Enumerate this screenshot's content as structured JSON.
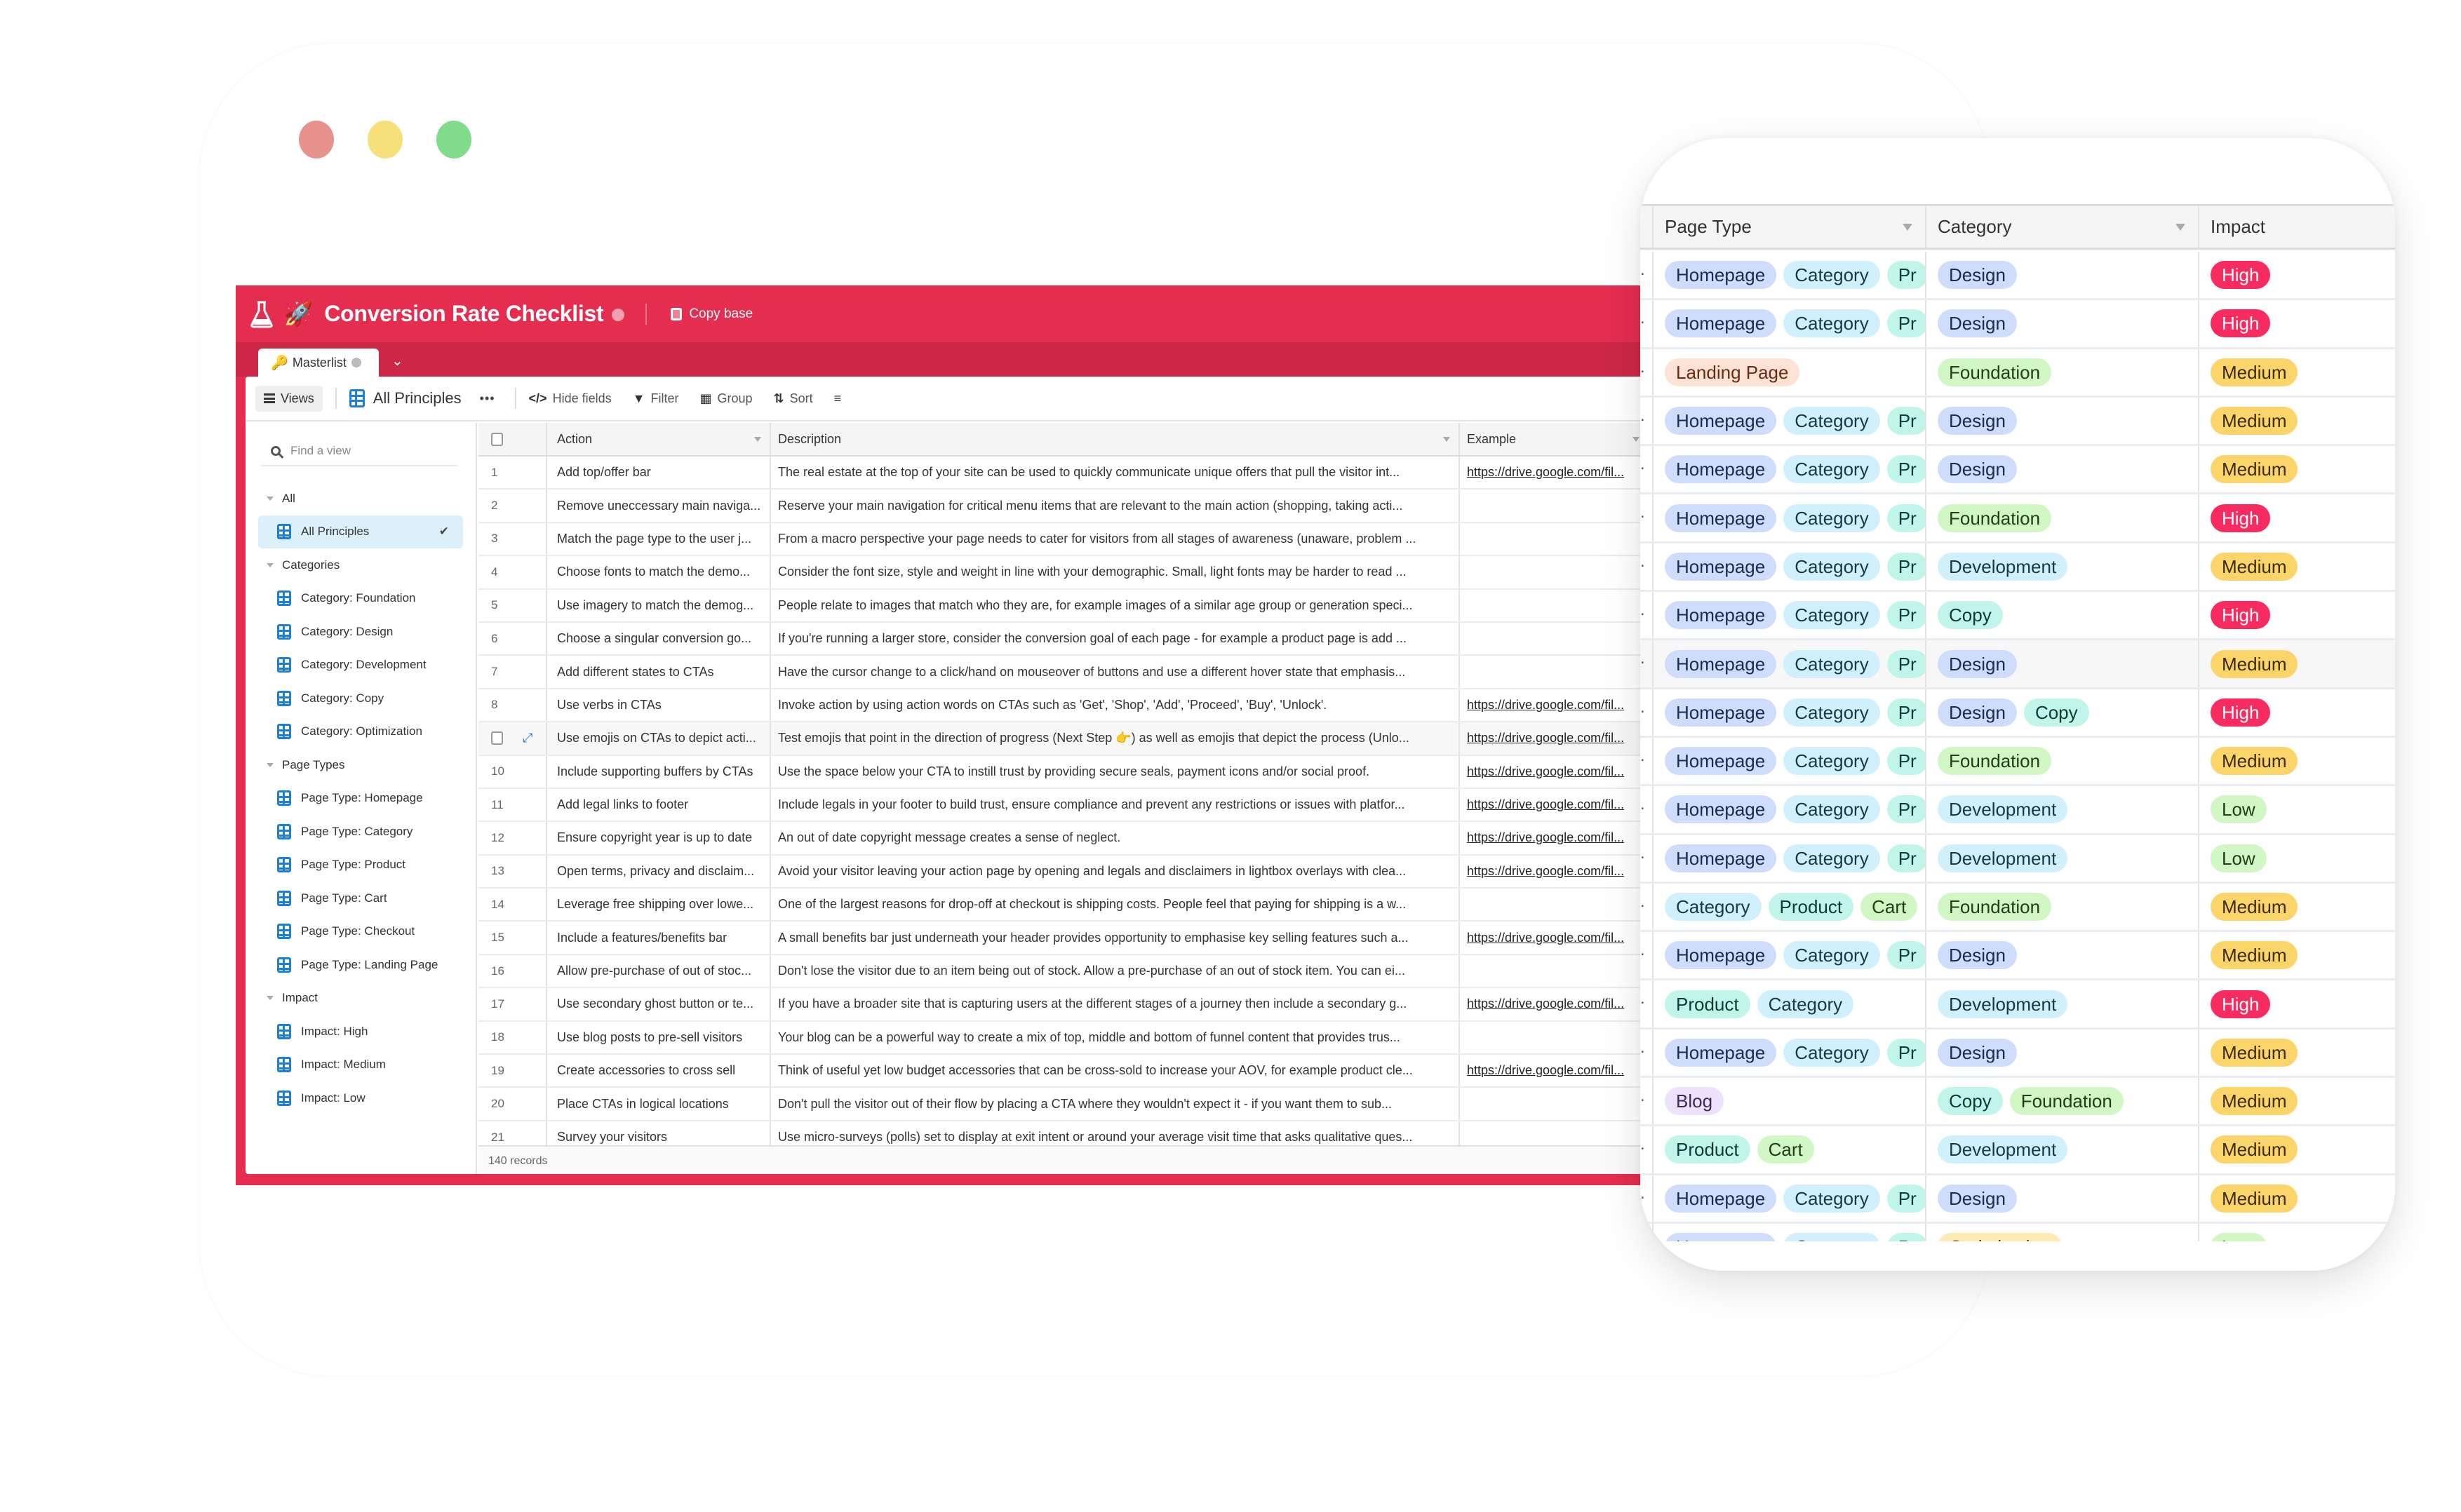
{
  "window_controls": [
    "close",
    "minimize",
    "maximize"
  ],
  "app": {
    "title": "Conversion Rate Checklist",
    "copy_base_label": "Copy base",
    "tab_label": "Masterlist",
    "toolbar": {
      "views_label": "Views",
      "current_view": "All Principles",
      "more_label": "•••",
      "hide_fields": "Hide fields",
      "filter": "Filter",
      "group": "Group",
      "sort": "Sort"
    },
    "sidebar": {
      "find_placeholder": "Find a view",
      "sections": [
        {
          "label": "All",
          "items": [
            {
              "label": "All Principles",
              "active": true
            }
          ]
        },
        {
          "label": "Categories",
          "items": [
            {
              "label": "Category: Foundation"
            },
            {
              "label": "Category: Design"
            },
            {
              "label": "Category: Development"
            },
            {
              "label": "Category: Copy"
            },
            {
              "label": "Category: Optimization"
            }
          ]
        },
        {
          "label": "Page Types",
          "items": [
            {
              "label": "Page Type: Homepage"
            },
            {
              "label": "Page Type: Category"
            },
            {
              "label": "Page Type: Product"
            },
            {
              "label": "Page Type: Cart"
            },
            {
              "label": "Page Type: Checkout"
            },
            {
              "label": "Page Type: Landing Page"
            }
          ]
        },
        {
          "label": "Impact",
          "items": [
            {
              "label": "Impact: High"
            },
            {
              "label": "Impact: Medium"
            },
            {
              "label": "Impact: Low"
            }
          ]
        }
      ]
    },
    "grid": {
      "columns": [
        "Action",
        "Description",
        "Example"
      ],
      "rows": [
        {
          "num": "1",
          "action": "Add top/offer bar",
          "description": "The real estate at the top of your site can be used to quickly communicate unique offers that pull the visitor int...",
          "example": "https://drive.google.com/fil..."
        },
        {
          "num": "2",
          "action": "Remove uneccessary main naviga...",
          "description": "Reserve your main navigation for critical menu items that are relevant to the main action (shopping, taking acti...",
          "example": ""
        },
        {
          "num": "3",
          "action": "Match the page type to the user j...",
          "description": "From a macro perspective your page needs to cater for visitors from all stages of awareness (unaware, problem ...",
          "example": ""
        },
        {
          "num": "4",
          "action": "Choose fonts to match the demo...",
          "description": "Consider the font size, style and weight in line with your demographic. Small, light fonts may be harder to read ...",
          "example": ""
        },
        {
          "num": "5",
          "action": "Use imagery to match the demog...",
          "description": "People relate to images that match who they are, for example images of a similar age group or generation speci...",
          "example": ""
        },
        {
          "num": "6",
          "action": "Choose a singular conversion go...",
          "description": "If you're running a larger store, consider the conversion goal of each page - for example a product page is add ...",
          "example": ""
        },
        {
          "num": "7",
          "action": "Add different states to CTAs",
          "description": "Have the cursor change to a click/hand on mouseover of buttons and use a different hover state that emphasis...",
          "example": ""
        },
        {
          "num": "8",
          "action": "Use verbs in CTAs",
          "description": "Invoke action by using action words on CTAs such as 'Get', 'Shop', 'Add', 'Proceed', 'Buy', 'Unlock'.",
          "example": "https://drive.google.com/fil..."
        },
        {
          "num": "",
          "hover": true,
          "action": "Use emojis on CTAs to depict acti...",
          "description": "Test emojis that point in the direction of progress (Next Step 👉) as well as emojis that depict the process (Unlo...",
          "example": "https://drive.google.com/fil..."
        },
        {
          "num": "10",
          "action": "Include supporting buffers by CTAs",
          "description": "Use the space below your CTA to instill trust by providing secure seals, payment icons and/or social proof.",
          "example": "https://drive.google.com/fil..."
        },
        {
          "num": "11",
          "action": "Add legal links to footer",
          "description": "Include legals in your footer to build trust, ensure compliance and prevent any restrictions or issues with platfor...",
          "example": "https://drive.google.com/fil..."
        },
        {
          "num": "12",
          "action": "Ensure copyright year is up to date",
          "description": "An out of date copyright message creates a sense of neglect.",
          "example": "https://drive.google.com/fil..."
        },
        {
          "num": "13",
          "action": "Open terms, privacy and disclaim...",
          "description": "Avoid your visitor leaving your action page by opening and legals and disclaimers in lightbox overlays with clea...",
          "example": "https://drive.google.com/fil..."
        },
        {
          "num": "14",
          "action": "Leverage free shipping over lowe...",
          "description": "One of the largest reasons for drop-off at checkout is shipping costs. People feel that paying for shipping is a w...",
          "example": ""
        },
        {
          "num": "15",
          "action": "Include a features/benefits bar",
          "description": "A small benefits bar just underneath your header provides opportunity to emphasise key selling features such a...",
          "example": "https://drive.google.com/fil..."
        },
        {
          "num": "16",
          "action": "Allow pre-purchase of out of stoc...",
          "description": "Don't lose the visitor due to an item being out of stock. Allow a pre-purchase of an out of stock item. You can ei...",
          "example": ""
        },
        {
          "num": "17",
          "action": "Use secondary ghost button or te...",
          "description": "If you have a broader site that is capturing users at the different stages of a journey then include a secondary g...",
          "example": "https://drive.google.com/fil..."
        },
        {
          "num": "18",
          "action": "Use blog posts to pre-sell visitors",
          "description": "Your blog can be a powerful way to create a mix of top, middle and bottom of funnel content that provides trus...",
          "example": ""
        },
        {
          "num": "19",
          "action": "Create accessories to cross sell",
          "description": "Think of useful yet low budget accessories that can be cross-sold to increase your AOV, for example product cle...",
          "example": "https://drive.google.com/fil..."
        },
        {
          "num": "20",
          "action": "Place CTAs in logical locations",
          "description": "Don't pull the visitor out of their flow by placing a CTA where they wouldn't expect it - if you want them to sub...",
          "example": ""
        },
        {
          "num": "21",
          "action": "Survey your visitors",
          "description": "Use micro-surveys (polls) set to display at exit intent or around your average visit time that asks qualitative ques...",
          "example": ""
        }
      ],
      "record_count": "140 records"
    }
  },
  "card": {
    "columns": [
      "Page Type",
      "Category",
      "Impact"
    ],
    "rows": [
      {
        "page_types": [
          "Homepage",
          "Category",
          "Pr"
        ],
        "categories": [
          "Design"
        ],
        "impact": "High"
      },
      {
        "page_types": [
          "Homepage",
          "Category",
          "Pr"
        ],
        "categories": [
          "Design"
        ],
        "impact": "High"
      },
      {
        "page_types": [
          "Landing Page"
        ],
        "categories": [
          "Foundation"
        ],
        "impact": "Medium"
      },
      {
        "page_types": [
          "Homepage",
          "Category",
          "Pr"
        ],
        "categories": [
          "Design"
        ],
        "impact": "Medium"
      },
      {
        "page_types": [
          "Homepage",
          "Category",
          "Pr"
        ],
        "categories": [
          "Design"
        ],
        "impact": "Medium"
      },
      {
        "page_types": [
          "Homepage",
          "Category",
          "Pr"
        ],
        "categories": [
          "Foundation"
        ],
        "impact": "High"
      },
      {
        "page_types": [
          "Homepage",
          "Category",
          "Pr"
        ],
        "categories": [
          "Development"
        ],
        "impact": "Medium"
      },
      {
        "page_types": [
          "Homepage",
          "Category",
          "Pr"
        ],
        "categories": [
          "Copy"
        ],
        "impact": "High"
      },
      {
        "page_types": [
          "Homepage",
          "Category",
          "Pr"
        ],
        "categories": [
          "Design"
        ],
        "impact": "Medium",
        "hover": true
      },
      {
        "page_types": [
          "Homepage",
          "Category",
          "Pr"
        ],
        "categories": [
          "Design",
          "Copy"
        ],
        "impact": "High"
      },
      {
        "page_types": [
          "Homepage",
          "Category",
          "Pr"
        ],
        "categories": [
          "Foundation"
        ],
        "impact": "Medium"
      },
      {
        "page_types": [
          "Homepage",
          "Category",
          "Pr"
        ],
        "categories": [
          "Development"
        ],
        "impact": "Low"
      },
      {
        "page_types": [
          "Homepage",
          "Category",
          "Pr"
        ],
        "categories": [
          "Development"
        ],
        "impact": "Low"
      },
      {
        "page_types": [
          "Category",
          "Product",
          "Cart"
        ],
        "categories": [
          "Foundation"
        ],
        "impact": "Medium"
      },
      {
        "page_types": [
          "Homepage",
          "Category",
          "Pr"
        ],
        "categories": [
          "Design"
        ],
        "impact": "Medium"
      },
      {
        "page_types": [
          "Product",
          "Category"
        ],
        "categories": [
          "Development"
        ],
        "impact": "High"
      },
      {
        "page_types": [
          "Homepage",
          "Category",
          "Pr"
        ],
        "categories": [
          "Design"
        ],
        "impact": "Medium"
      },
      {
        "page_types": [
          "Blog"
        ],
        "categories": [
          "Copy",
          "Foundation"
        ],
        "impact": "Medium"
      },
      {
        "page_types": [
          "Product",
          "Cart"
        ],
        "categories": [
          "Development"
        ],
        "impact": "Medium"
      },
      {
        "page_types": [
          "Homepage",
          "Category",
          "Pr"
        ],
        "categories": [
          "Design"
        ],
        "impact": "Medium"
      },
      {
        "page_types": [
          "Homepage",
          "Category",
          "Pr"
        ],
        "categories": [
          "Optimization"
        ],
        "impact": "Low"
      }
    ]
  },
  "colors": {
    "header": "#E52D50",
    "tab_bar": "#CC2846",
    "accent_blue": "#1E7FD9",
    "impact_high": "#F82B60",
    "impact_medium": "#FCD56A",
    "impact_low": "#D1F7C4"
  }
}
